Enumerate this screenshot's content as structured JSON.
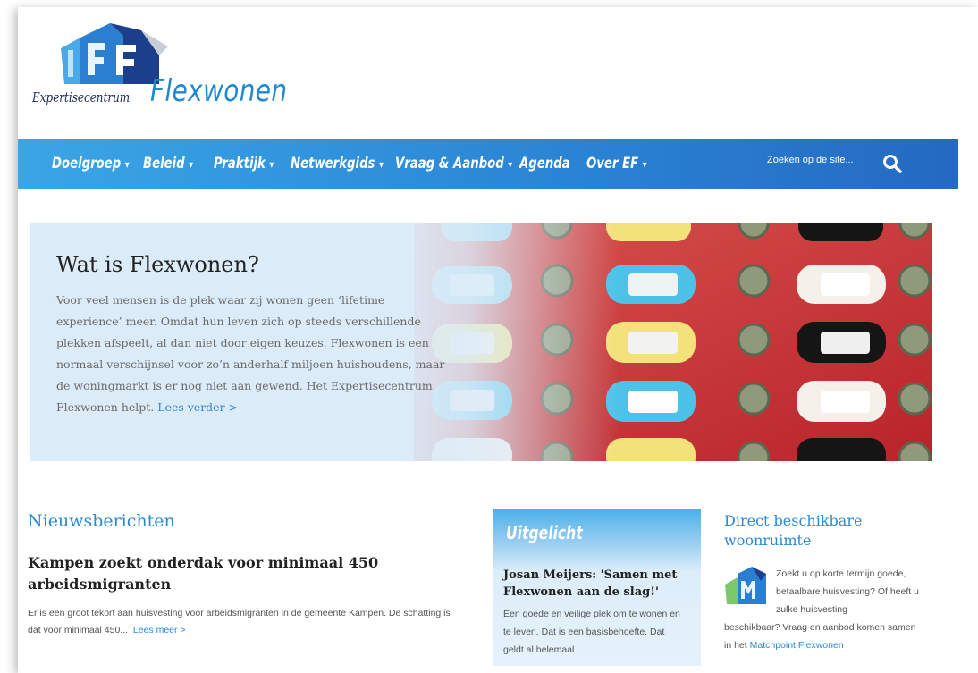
{
  "logo": {
    "small_text": "Expertisecentrum",
    "big_text": "Flexwonen"
  },
  "nav": {
    "items": [
      {
        "label": "Doelgroep",
        "caret": "▾"
      },
      {
        "label": "Beleid",
        "caret": "▾"
      },
      {
        "label": "Praktijk",
        "caret": "▾"
      },
      {
        "label": "Netwerkgids",
        "caret": "▾"
      },
      {
        "label": "Vraag & Aanbod",
        "caret": "▾"
      },
      {
        "label": "Agenda",
        "caret": ""
      },
      {
        "label": "Over EF",
        "caret": "▾"
      }
    ],
    "search_placeholder": "Zoeken op de site..."
  },
  "hero": {
    "title": "Wat is Flexwonen?",
    "text": "Voor veel mensen is de plek waar zij wonen geen ‘lifetime experience’ meer. Omdat hun leven zich op steeds verschillende plekken afspeelt, al dan niet door eigen keuzes. Flexwonen is een normaal verschijnsel voor zo’n anderhalf miljoen huishoudens, maar de woningmarkt is er nog niet aan gewend. Het Expertisecentrum Flexwonen helpt.",
    "link": "Lees verder >"
  },
  "news": {
    "title": "Nieuwsberichten",
    "article_title": "Kampen zoekt onderdak voor minimaal 450 arbeidsmigranten",
    "article_text": "Er is een groot tekort aan huisvesting voor arbeidsmigranten in de gemeente Kampen. De schatting is dat voor minimaal 450...",
    "article_link": "Lees meer >"
  },
  "featured": {
    "heading": "Uitgelicht",
    "title": "Josan Meijers: 'Samen met Flexwonen aan de slag!'",
    "text": "Een goede en veilige plek om te wonen en te leven. Dat is een basisbehoefte. Dat geldt al helemaal"
  },
  "side": {
    "title": "Direct beschikbare woonruimte",
    "text_part1": "Zoekt u op korte termijn goede, betaalbare huisvesting? Of heeft u zulke huisvesting",
    "text_part2": "beschikbaar? Vraag en aanbod komen samen in het",
    "link": "Matchpoint Flexwonen"
  }
}
